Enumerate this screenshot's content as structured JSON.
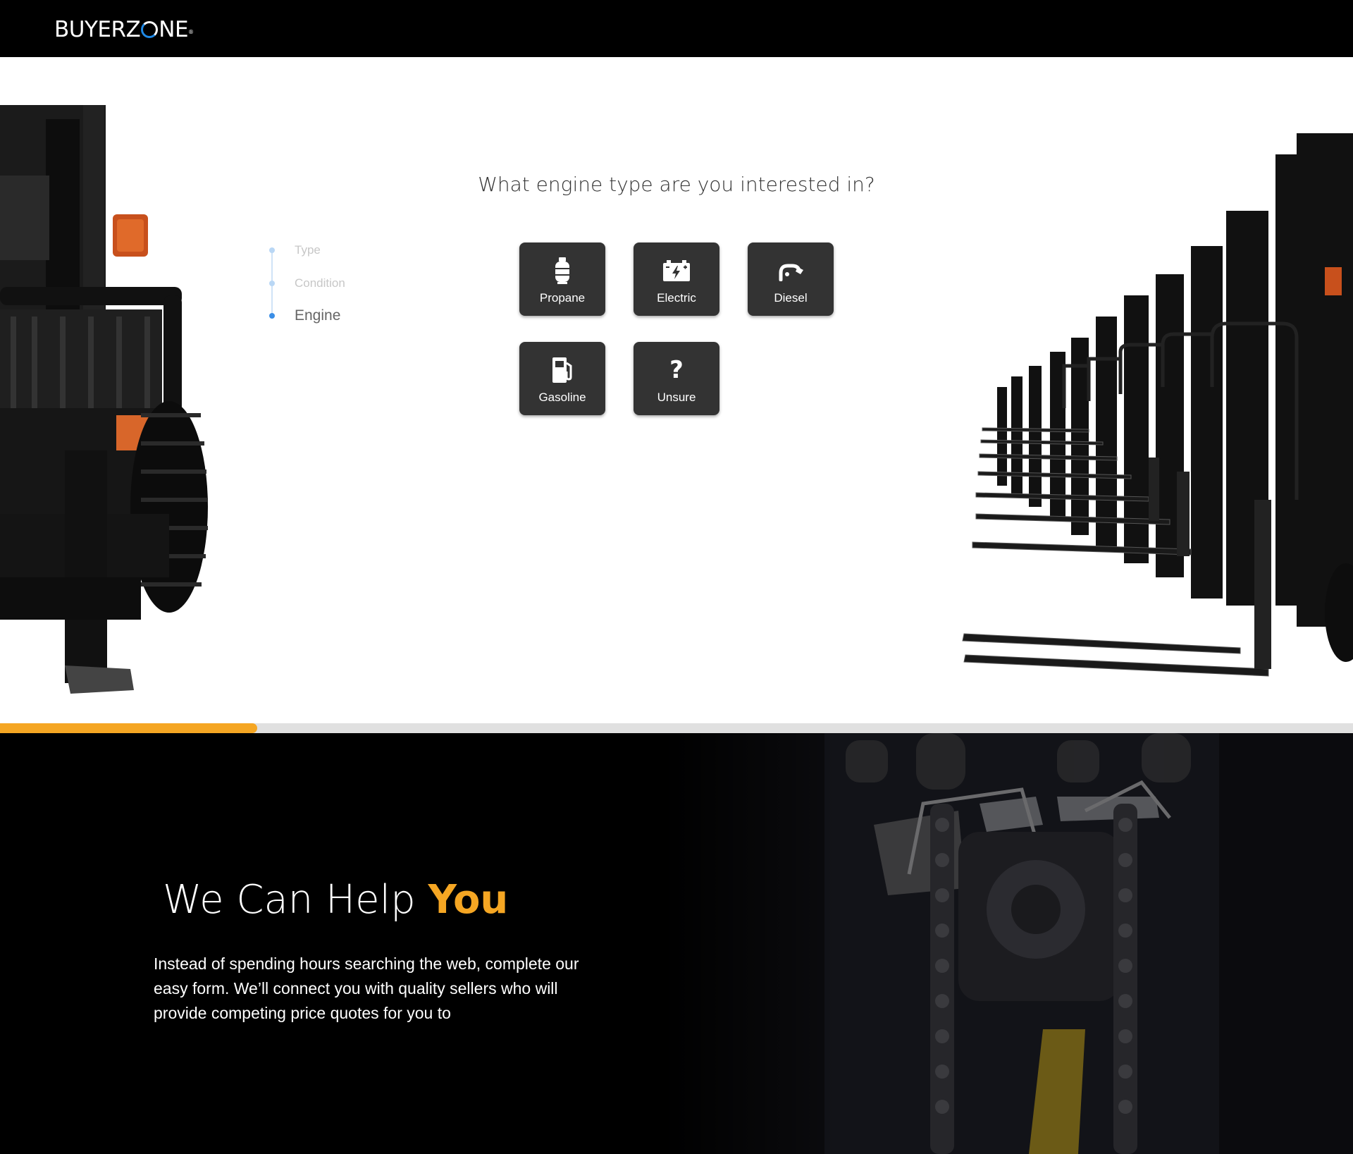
{
  "header": {
    "logo_text_1": "BUYERZ",
    "logo_text_2": "NE",
    "logo_mark": "®"
  },
  "main": {
    "question": "What engine type are you interested in?",
    "steps": [
      {
        "label": "Type",
        "state": "done"
      },
      {
        "label": "Condition",
        "state": "done"
      },
      {
        "label": "Engine",
        "state": "active"
      }
    ],
    "options": [
      {
        "label": "Propane",
        "icon": "propane-tank-icon"
      },
      {
        "label": "Electric",
        "icon": "battery-icon"
      },
      {
        "label": "Diesel",
        "icon": "fuel-nozzle-icon"
      },
      {
        "label": "Gasoline",
        "icon": "gas-pump-icon"
      },
      {
        "label": "Unsure",
        "icon": "question-mark-icon",
        "glyph": "?"
      }
    ]
  },
  "progress": {
    "fraction": 0.19,
    "color": "#f5a623"
  },
  "help": {
    "title_plain": "We Can Help",
    "title_accent": "You",
    "body": "Instead of spending hours searching the web, complete our easy form. We’ll connect you with quality sellers who will provide competing price quotes for you to"
  },
  "colors": {
    "accent": "#f5a623",
    "tile_bg": "#333333",
    "step_active": "#3a8ee6"
  }
}
